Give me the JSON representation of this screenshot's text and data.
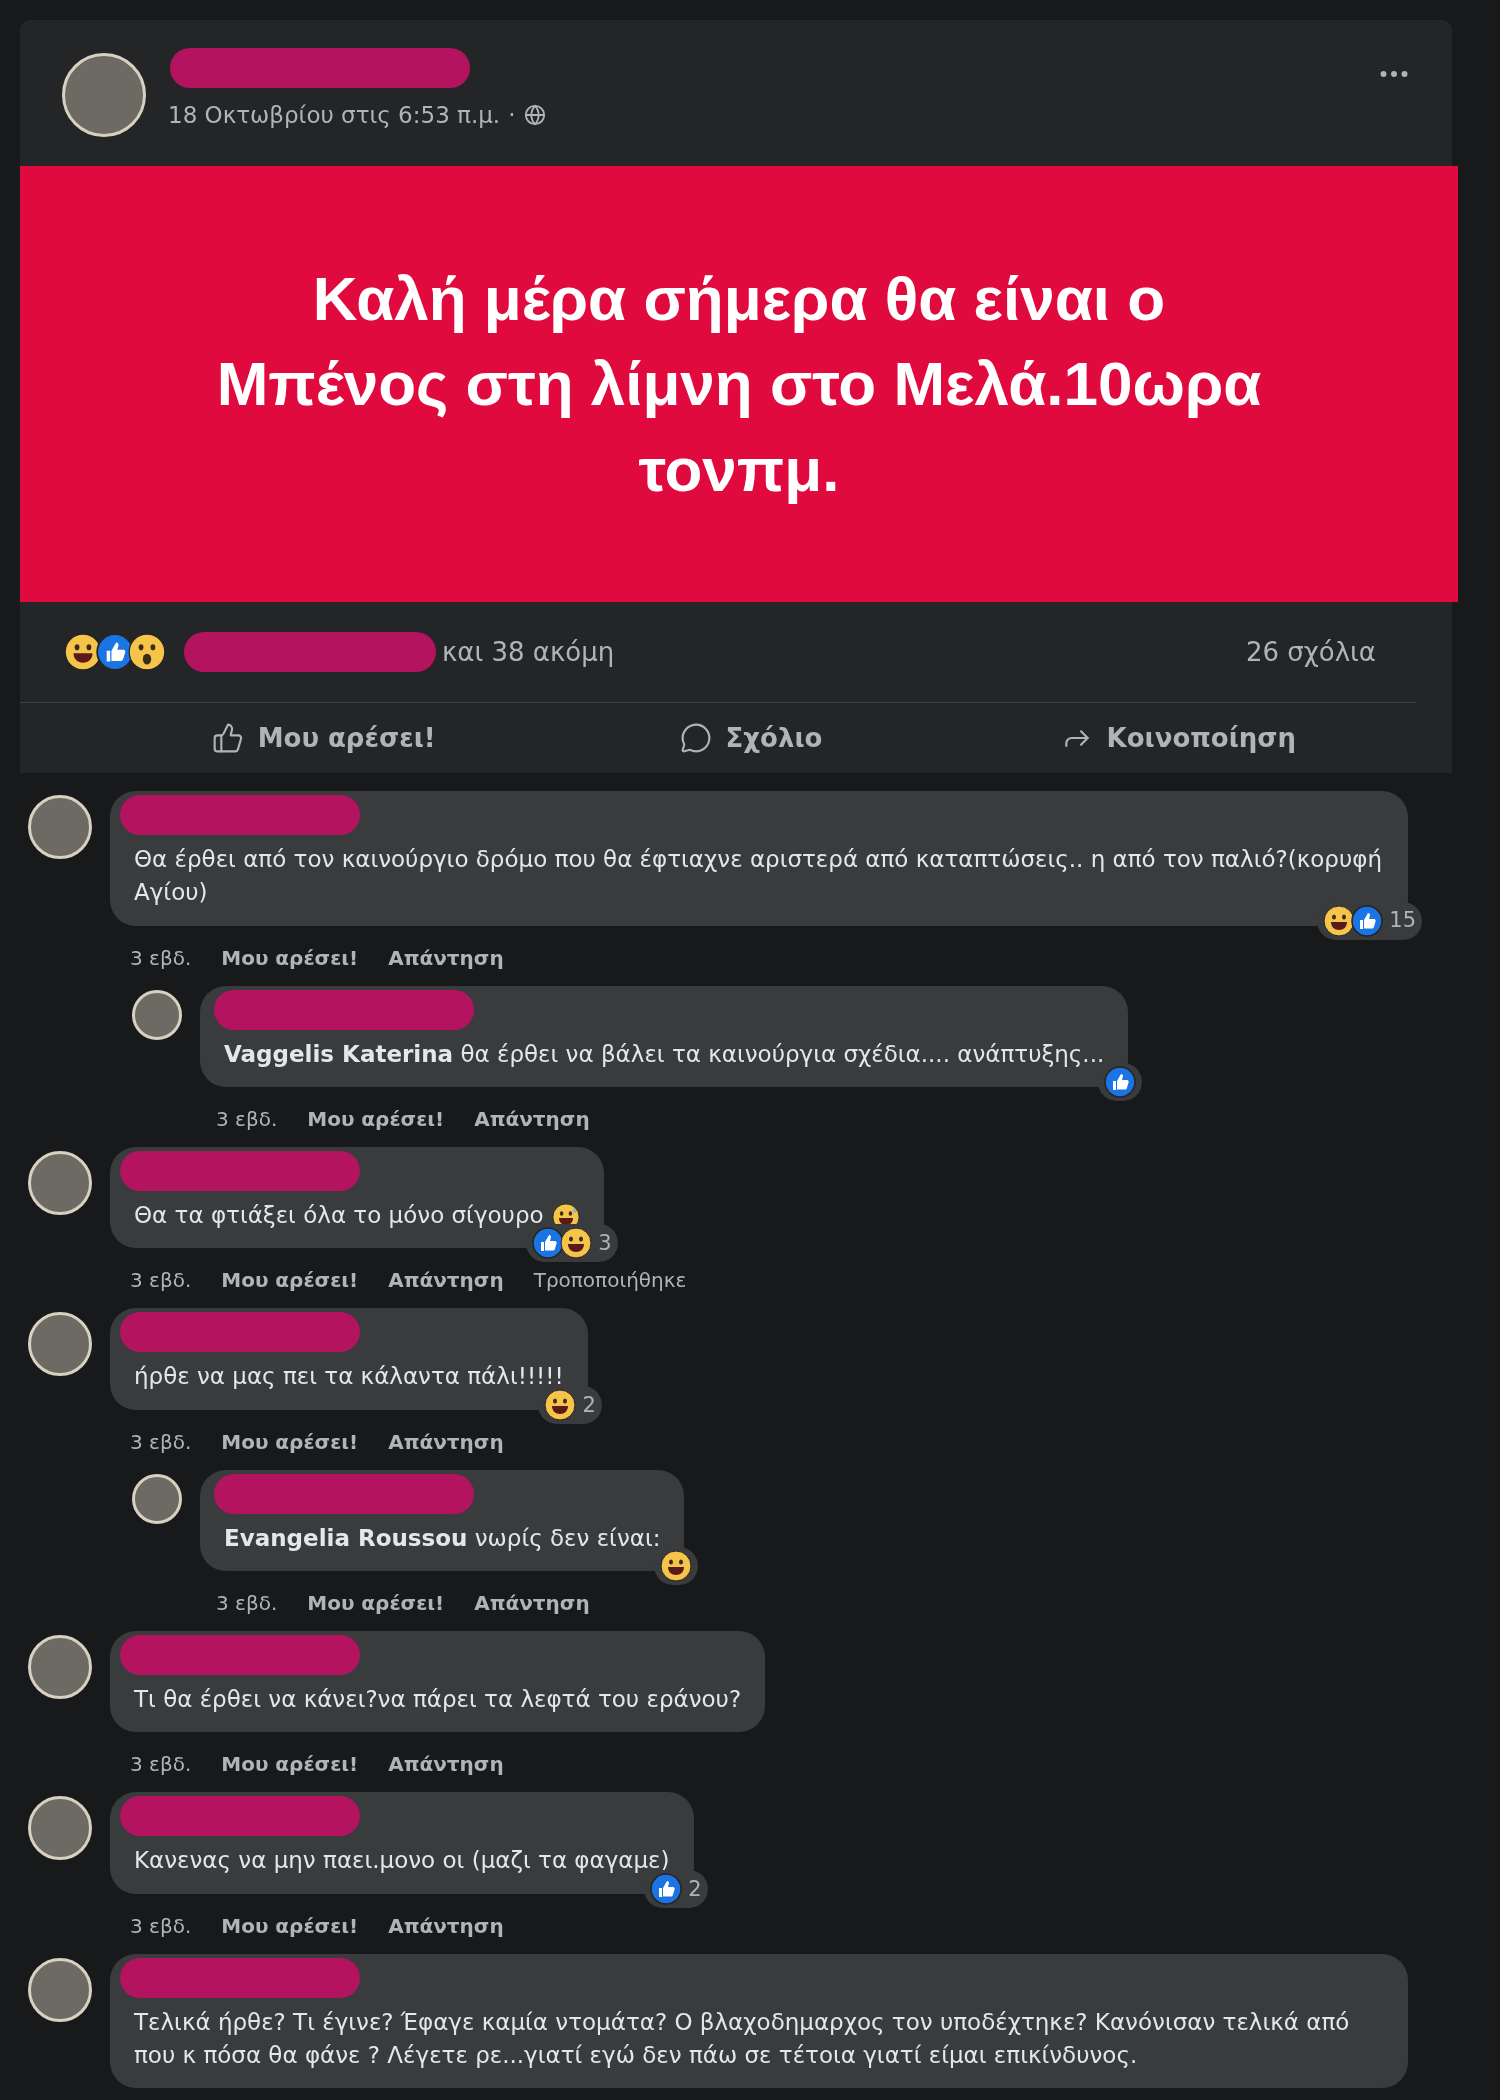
{
  "post": {
    "timestamp": "18 Οκτωβρίου στις 6:53 π.μ.",
    "separator": "·",
    "banner_text": "Καλή μέρα σήμερα θα είναι ο Μπένος στη λίμνη στο Μελά.10ωρα τονπμ.",
    "reactions": [
      {
        "kind": "haha"
      },
      {
        "kind": "like"
      },
      {
        "kind": "wow"
      }
    ],
    "reactors_more": "και 38 ακόμη",
    "comment_count": "26 σχόλια",
    "actions": [
      {
        "kind": "like",
        "label": "Μου αρέσει!"
      },
      {
        "kind": "comment",
        "label": "Σχόλιο"
      },
      {
        "kind": "share",
        "label": "Κοινοποίηση"
      }
    ]
  },
  "comments": [
    {
      "kind": "comment",
      "text": "Θα έρθει από τον καινούργιο δρόμο που θα έφτιαχνε αριστερά από καταπτώσεις.. η από τον παλιό?(κορυφή Αγίου)",
      "reactions": [
        {
          "kind": "haha"
        },
        {
          "kind": "like"
        }
      ],
      "reaction_count": "15",
      "time": "3 εβδ.",
      "actions": [
        "Μου αρέσει!",
        "Απάντηση"
      ]
    },
    {
      "kind": "reply",
      "text": "**Vaggelis Katerina** θα έρθει να βάλει τα καινούργια σχέδια.... ανάπτυξης...",
      "reactions": [
        {
          "kind": "like"
        }
      ],
      "time": "3 εβδ.",
      "actions": [
        "Μου αρέσει!",
        "Απάντηση"
      ]
    },
    {
      "kind": "comment",
      "text": "Θα τα φτιάξει όλα το μόνο σίγουρο",
      "emoji": {
        "kind": "sweat-smile"
      },
      "reactions": [
        {
          "kind": "like"
        },
        {
          "kind": "haha"
        }
      ],
      "reaction_count": "3",
      "time": "3 εβδ.",
      "actions": [
        "Μου αρέσει!",
        "Απάντηση"
      ],
      "edited": "Τροποποιήθηκε"
    },
    {
      "kind": "comment",
      "text": "ήρθε να μας πει τα κάλαντα πάλι!!!!!",
      "reactions": [
        {
          "kind": "haha"
        }
      ],
      "reaction_count": "2",
      "time": "3 εβδ.",
      "actions": [
        "Μου αρέσει!",
        "Απάντηση"
      ]
    },
    {
      "kind": "reply",
      "text": "**Evangelia Roussou** νωρίς δεν είναι:",
      "reactions": [
        {
          "kind": "haha"
        }
      ],
      "time": "3 εβδ.",
      "actions": [
        "Μου αρέσει!",
        "Απάντηση"
      ]
    },
    {
      "kind": "comment",
      "text": "Τι θα έρθει να κάνει?να πάρει τα λεφτά του εράνου?",
      "time": "3 εβδ.",
      "actions": [
        "Μου αρέσει!",
        "Απάντηση"
      ]
    },
    {
      "kind": "comment",
      "text": "Κανενας να μην παει.μονο οι (μαζι τα φαγαμε)",
      "reactions": [
        {
          "kind": "like"
        }
      ],
      "reaction_count": "2",
      "time": "3 εβδ.",
      "actions": [
        "Μου αρέσει!",
        "Απάντηση"
      ]
    },
    {
      "kind": "comment",
      "text": "Τελικά ήρθε? Τι έγινε? Έφαγε καμία ντομάτα? Ο βλαχοδημαρχος τον υποδέχτηκε? Κανόνισαν τελικά από που κ πόσα θα φάνε ? Λέγετε ρε...γιατί εγώ δεν πάω σε τέτοια γιατί είμαι επικίνδυνος."
    }
  ]
}
